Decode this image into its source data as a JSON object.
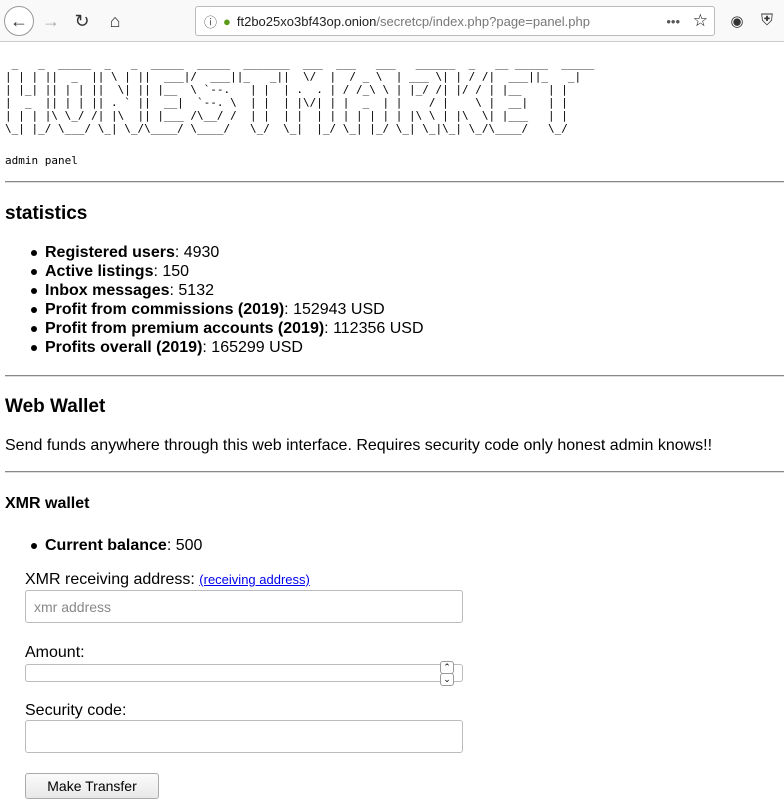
{
  "browser": {
    "url_host": "ft2bo25xo3bf43op.onion",
    "url_path": "/secretcp/index.php?page=panel.php",
    "icons": [
      "back-icon",
      "forward-icon",
      "reload-icon",
      "home-icon",
      "info-icon",
      "onion-icon",
      "more-icon",
      "star-icon",
      "tor-icon",
      "shield-icon"
    ]
  },
  "banner": {
    "ascii_art_text": "HONESTMARKET",
    "lines": [
      " _   _  _____  _   _  _____  _____  _______  ___  ___   ___   ______  _   __ _____  _____ ",
      "| | | ||  _  || \\ | ||  ___|/  ___||_   _||  \\/  |  / _ \\  | ___ \\| | / /|  ___||_   _|",
      "| |_| || | | ||  \\| || |__  \\ `--.   | |  | .  . | / /_\\ \\ | |_/ /| |/ / | |__    | |  ",
      "|  _  || | | || . ` ||  __|  `--. \\  | |  | |\\/| | |  _  | |    / |    \\ |  __|   | |  ",
      "| | | |\\ \\_/ /| |\\  || |___ /\\__/ /  | |  | |  | | | | | | | |\\ \\ | |\\  \\| |___   | |  ",
      "\\_| |_/ \\___/ \\_| \\_/\\____/ \\____/   \\_/  \\_|  |_/ \\_| |_/ \\_| \\_|\\_| \\_/\\____/   \\_/  "
    ],
    "subtitle": "admin panel"
  },
  "statistics": {
    "title": "statistics",
    "items": [
      {
        "label": "Registered users",
        "value": "4930"
      },
      {
        "label": "Active listings",
        "value": "150"
      },
      {
        "label": "Inbox messages",
        "value": "5132"
      },
      {
        "label": "Profit from commissions (2019)",
        "value": "152943 USD"
      },
      {
        "label": "Profit from premium accounts (2019)",
        "value": "112356 USD"
      },
      {
        "label": "Profits overall (2019)",
        "value": "165299 USD"
      }
    ]
  },
  "wallet": {
    "title": "Web Wallet",
    "description": "Send funds anywhere through this web interface. Requires security code only honest admin knows!!",
    "subtitle": "XMR wallet",
    "balance_label": "Current balance",
    "balance_value": "500",
    "address_label": "XMR receiving address:",
    "address_link": "(receiving address)",
    "address_placeholder": "xmr address",
    "amount_label": "Amount:",
    "security_label": "Security code:",
    "submit": "Make Transfer"
  }
}
